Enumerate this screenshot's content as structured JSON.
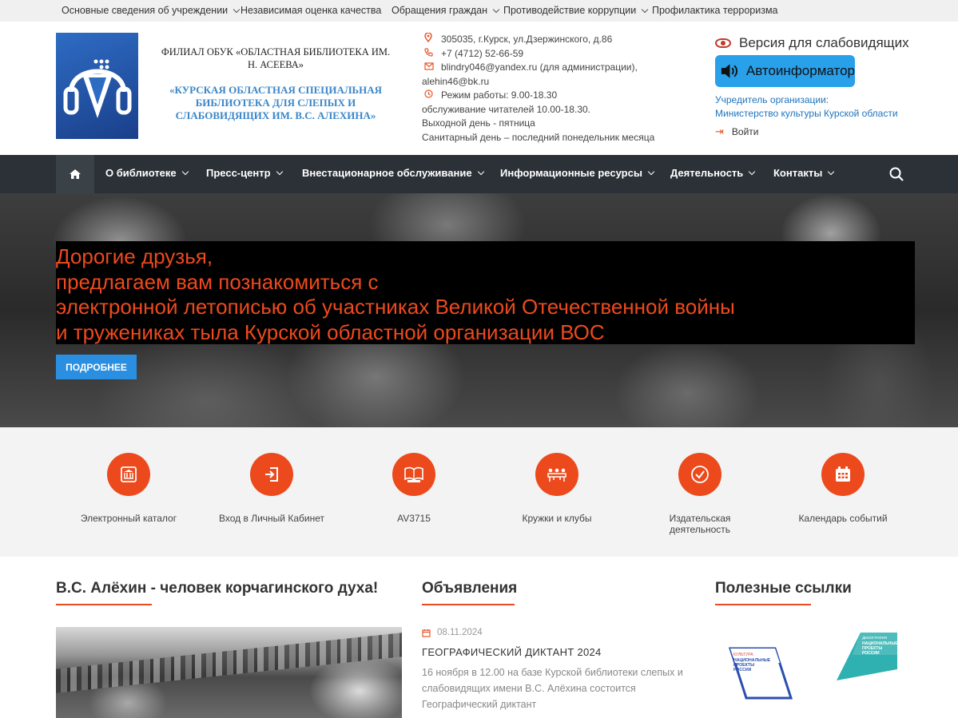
{
  "topbar": {
    "items": [
      {
        "label": "Основные сведения об учреждении",
        "dropdown": true
      },
      {
        "label": "Независимая оценка качества",
        "dropdown": false
      },
      {
        "label": "Обращения граждан",
        "dropdown": true
      },
      {
        "label": "Противодействие коррупции",
        "dropdown": true
      },
      {
        "label": "Профилактика терроризма",
        "dropdown": false
      }
    ]
  },
  "header": {
    "org_line1": "Филиал ОБУК «Областная библиотека им. Н. Асеева»",
    "org_line2": "«КУРСКАЯ ОБЛАСТНАЯ СПЕЦИАЛЬНАЯ БИБЛИОТЕКА ДЛЯ СЛЕПЫХ И СЛАБОВИДЯЩИХ ИМ. В.С. АЛЕХИНА»",
    "contacts": {
      "address": "305035, г.Курск, ул.Дзержинского, д.86",
      "phone": "+7 (4712) 52-66-59",
      "email_line1": "blindry046@yandex.ru (для администрации),",
      "email_line2": "alehin46@bk.ru",
      "hours_line1": "Режим работы: 9.00-18.30",
      "hours_line2": "обслуживание читателей 10.00-18.30.",
      "day_off": "Выходной день - пятница",
      "sanitary": "Санитарный день – последний понедельник месяца"
    },
    "vision_label": "Версия для слабовидящих",
    "autoinformer_label": "Автоинформатор",
    "founder_label": "Учредитель организации:",
    "founder_name": "Министерство культуры Курской области",
    "login_label": "Войти"
  },
  "nav": {
    "items": [
      {
        "label": "О библиотеке"
      },
      {
        "label": "Пресс-центр"
      },
      {
        "label": "Внестационарное обслуживание"
      },
      {
        "label": "Информационные ресурсы"
      },
      {
        "label": "Деятельность"
      },
      {
        "label": "Контакты"
      }
    ]
  },
  "hero": {
    "lines": [
      "Дорогие друзья,",
      "предлагаем вам познакомиться с",
      "электронной летописью об участниках Великой Отечественной войны",
      "и тружениках тыла Курской областной организации ВОС"
    ],
    "button_label": "Подробнее"
  },
  "services": [
    {
      "label": "Электронный каталог",
      "icon": "catalog-icon"
    },
    {
      "label": "Вход в Личный Кабинет",
      "icon": "login-icon"
    },
    {
      "label": "AV3715",
      "icon": "reader-device-icon"
    },
    {
      "label": "Кружки и клубы",
      "icon": "clubs-icon"
    },
    {
      "label": "Издательская деятельность",
      "icon": "check-icon"
    },
    {
      "label": "Календарь событий",
      "icon": "calendar-icon"
    }
  ],
  "sections": {
    "article_title": "В.С. Алёхин - человек корчагинского духа!",
    "announcements_title": "Объявления",
    "links_title": "Полезные ссылки"
  },
  "announcement": {
    "date": "08.11.2024",
    "title": "ГЕОГРАФИЧЕСКИЙ ДИКТАНТ 2024",
    "text": "16 ноября в 12.00 на базе Курской библиотеки слепых и слабовидящих имени В.С. Алёхина состоится Географический диктант"
  },
  "links": {
    "badge1_lines": [
      "КУЛЬТУРА",
      "НАЦИОНАЛЬНЫЕ",
      "ПРОЕКТЫ",
      "РОССИИ"
    ],
    "badge2_lines": [
      "ДЕМОГРАФИЯ",
      "НАЦИОНАЛЬНЫЕ",
      "ПРОЕКТЫ",
      "РОССИИ"
    ]
  },
  "colors": {
    "accent": "#ec4a1d",
    "nav_bg": "#2b3136",
    "button_blue": "#2a8fe0",
    "autoinformer_bg": "#28a0ea",
    "link_blue": "#1e73be"
  }
}
